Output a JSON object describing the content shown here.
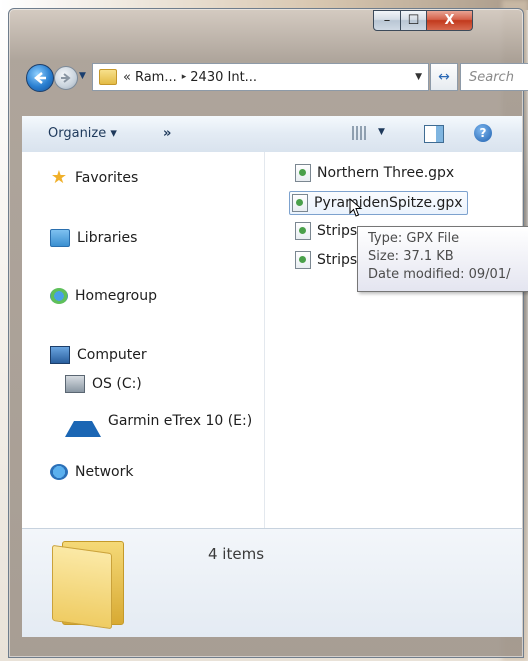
{
  "window": {
    "caption": {
      "minimize": "–",
      "maximize": "☐",
      "close": "X"
    }
  },
  "nav": {
    "breadcrumb_prefix": "«",
    "crumbs": [
      "Ram...",
      "2430 Int..."
    ],
    "crumb_separator": "▸",
    "search_placeholder": "Search"
  },
  "toolbar": {
    "organize_label": "Organize ▾",
    "more_label": "»",
    "help_label": "?"
  },
  "sidebar": {
    "favorites": "Favorites",
    "libraries": "Libraries",
    "homegroup": "Homegroup",
    "computer": "Computer",
    "drives": [
      "OS (C:)",
      "Garmin eTrex 10 (E:)"
    ],
    "network": "Network"
  },
  "files": [
    "Northern Three.gpx",
    "PyramidenSpitze.gpx",
    "Strips",
    "Strips"
  ],
  "tooltip": {
    "type": "Type: GPX File",
    "size": "Size: 37.1 KB",
    "modified": "Date modified: 09/01/"
  },
  "details": {
    "item_count": "4 items"
  },
  "colors": {
    "close_button": "#c2391c",
    "command_bar": "#e3ebf4",
    "selection_border": "#7da2ce"
  }
}
